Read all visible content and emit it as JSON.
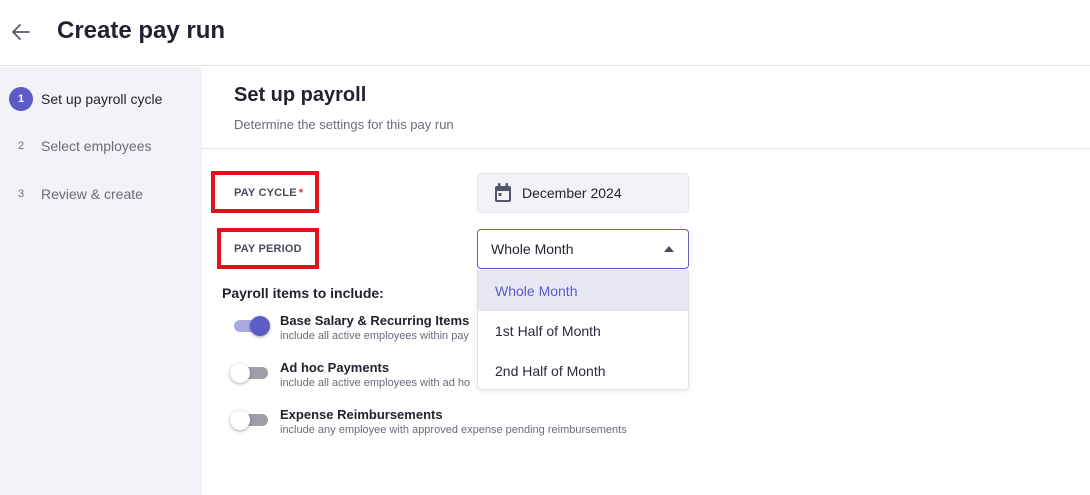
{
  "header": {
    "title": "Create pay run",
    "back_icon": "arrow-left-icon"
  },
  "sidebar": {
    "steps": [
      {
        "number": "1",
        "label": "Set up payroll cycle",
        "active": true
      },
      {
        "number": "2",
        "label": "Select employees",
        "active": false
      },
      {
        "number": "3",
        "label": "Review & create",
        "active": false
      }
    ]
  },
  "main": {
    "title": "Set up payroll",
    "subtitle": "Determine the settings for this pay run",
    "pay_cycle": {
      "label": "PAY CYCLE",
      "required_mark": "*",
      "value": "December 2024",
      "icon": "calendar-icon"
    },
    "pay_period": {
      "label": "PAY PERIOD",
      "value": "Whole Month",
      "options": [
        "Whole Month",
        "1st Half of Month",
        "2nd Half of Month"
      ]
    },
    "payroll_items": {
      "title": "Payroll items to include:",
      "items": [
        {
          "title": "Base Salary & Recurring Items",
          "description": "include all active employees within pay",
          "enabled": true
        },
        {
          "title": "Ad hoc Payments",
          "description": "include all active employees with ad ho",
          "enabled": false
        },
        {
          "title": "Expense Reimbursements",
          "description": "include any employee with approved expense pending reimbursements",
          "enabled": false
        }
      ]
    }
  },
  "colors": {
    "accent": "#5b5cc6",
    "highlight_box": "#e0111c",
    "required": "#e0303a"
  }
}
